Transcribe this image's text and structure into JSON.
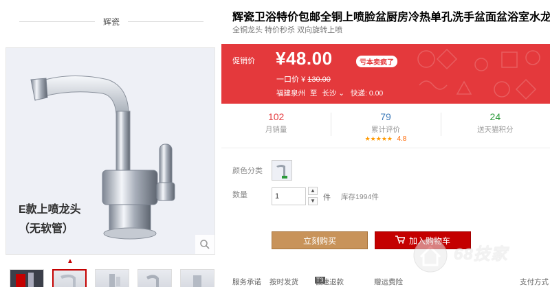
{
  "shop": {
    "name": "辉瓷"
  },
  "product": {
    "title": "辉瓷卫浴特价包邮全铜上喷脸盆厨房冷热单孔洗手盆面盆浴室水龙头",
    "subtitle": "全铜龙头 特价秒杀 双向旋转上喷",
    "image_caption_line1": "E款上喷龙头",
    "image_caption_line2": "（无软管）"
  },
  "price": {
    "label": "促销价",
    "value": "¥48.00",
    "badge": "亏本卖疯了",
    "original_label": "一口价",
    "original_currency": "¥",
    "original_value": "130.00",
    "ship_from": "福建泉州",
    "ship_to_word": "至",
    "ship_dest": "长沙",
    "shipping_fee": "快递: 0.00"
  },
  "stats": {
    "sales": {
      "value": "102",
      "label": "月销量"
    },
    "reviews": {
      "value": "79",
      "label": "累计评价",
      "stars": "★★★★★",
      "rating": "4.8"
    },
    "points": {
      "value": "24",
      "label": "送天猫积分"
    }
  },
  "options": {
    "color_label": "颜色分类",
    "qty_label": "数量",
    "qty_value": "1",
    "qty_unit": "件",
    "stock": "库存1994件"
  },
  "actions": {
    "buy_now": "立刻购买",
    "add_cart": "加入购物车"
  },
  "service": {
    "label": "服务承诺",
    "item1": "按时发货",
    "t3": "T3",
    "item2": "极速退款",
    "item3": "赠运费险",
    "payment": "支付方式"
  },
  "watermark": {
    "text": "68技家"
  },
  "icons": {
    "zoom": "magnifier-icon",
    "thumb_up": "chevron-up-icon",
    "cart": "cart-icon"
  },
  "colors": {
    "price_panel": "#e4393c",
    "buy_button": "#c8935a",
    "cart_button": "#c40000"
  }
}
